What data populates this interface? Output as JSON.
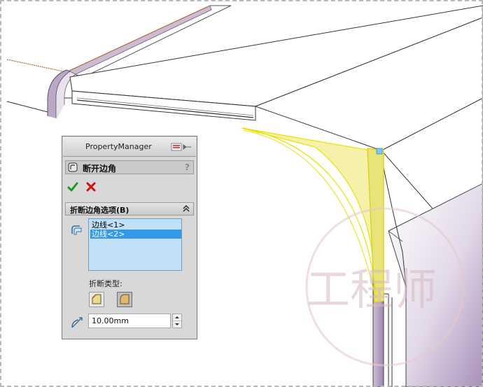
{
  "property_manager": {
    "title": "PropertyManager",
    "feature_title": "断开边角",
    "help_glyph": "?",
    "group_title": "折断边角选项(B)",
    "selections": [
      "边线<1>",
      "边线<2>"
    ],
    "selected_index": 1,
    "break_type_label": "折断类型:",
    "distance_value": "10.00mm"
  },
  "watermark_text": "工程师",
  "colors": {
    "highlight_face": "#f3ef9c",
    "highlight_edge": "#e8e200",
    "selection_blue": "#3399e6",
    "list_bg": "#bfe0f6",
    "ok_green": "#1a9a1a",
    "cancel_red": "#d01010",
    "model_purple": "#b9a6c4"
  },
  "icons": [
    "pin-icon",
    "break-corner-icon",
    "help-icon",
    "check-icon",
    "x-icon",
    "collapse-icon",
    "edge-selection-icon",
    "chamfer-icon",
    "fillet-icon",
    "distance-icon"
  ]
}
